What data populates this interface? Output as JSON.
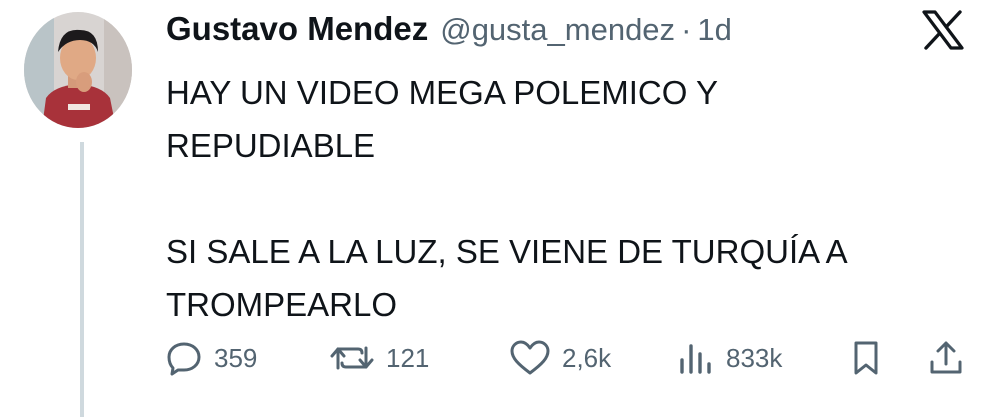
{
  "tweet": {
    "author": {
      "name": "Gustavo Mendez",
      "handle": "@gusta_mendez",
      "separator": "·",
      "time": "1d",
      "avatar_icon": "user-avatar-photo"
    },
    "platform_icon": "x-logo-icon",
    "text_lines": [
      "HAY UN VIDEO MEGA POLEMICO Y",
      "REPUDIABLE",
      "",
      "SI SALE A LA LUZ, SE VIENE DE TURQUÍA A",
      "TROMPEARLO"
    ],
    "actions": {
      "replies": {
        "icon": "reply-icon",
        "count": "359"
      },
      "reposts": {
        "icon": "repost-icon",
        "count": "121"
      },
      "likes": {
        "icon": "heart-icon",
        "count": "2,6k"
      },
      "views": {
        "icon": "views-icon",
        "count": "833k"
      },
      "bookmark": {
        "icon": "bookmark-icon"
      },
      "share": {
        "icon": "share-icon"
      }
    },
    "colors": {
      "text": "#0f1419",
      "secondary": "#536471",
      "thread_line": "#cfd9de"
    }
  }
}
